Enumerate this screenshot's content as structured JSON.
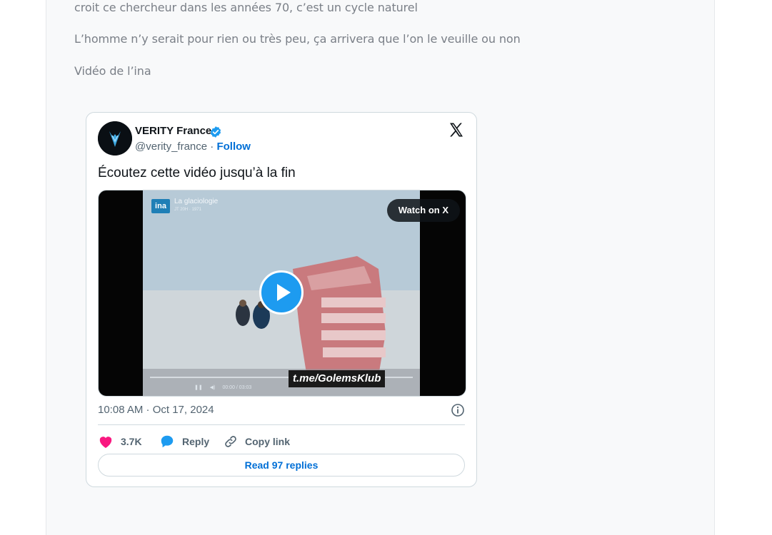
{
  "article": {
    "lines": [
      "croit ce chercheur dans les années 70, c’est un cycle naturel",
      "L’homme n’y serait pour rien ou très peu, ça arrivera que l’on le veuille ou non",
      "Vidéo de l’ina"
    ]
  },
  "tweet": {
    "author_name": "VERITY France",
    "handle": "@verity_france",
    "separator": " · ",
    "follow_label": "Follow",
    "text": "Écoutez cette vidéo jusqu’à la fin",
    "media": {
      "ina_logo": "ina",
      "video_title": "La glaciologie",
      "video_subtitle": "JT 20H · 1971",
      "watch_label": "Watch on X",
      "caption": "t.me/GolemsKlub",
      "controls_time": "00:00 / 03:03"
    },
    "timestamp": "10:08 AM · Oct 17, 2024",
    "likes": "3.7K",
    "reply_label": "Reply",
    "copy_label": "Copy link",
    "read_replies": "Read 97 replies",
    "colors": {
      "like": "#f91880",
      "reply": "#1d9bf0",
      "link": "#006fd6",
      "verified": "#1d9bf0"
    }
  },
  "icons": [
    "verified-badge-icon",
    "x-logo-icon",
    "play-icon",
    "info-icon",
    "heart-icon",
    "reply-bubble-icon",
    "link-icon"
  ]
}
